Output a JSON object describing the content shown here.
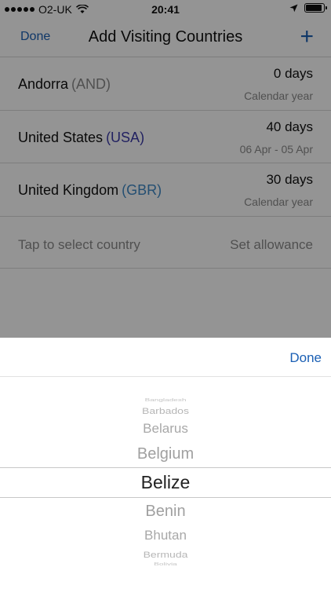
{
  "status": {
    "carrier": "O2-UK",
    "time": "20:41"
  },
  "nav": {
    "done": "Done",
    "title": "Add Visiting Countries",
    "add": "+"
  },
  "countries": [
    {
      "name": "Andorra",
      "code": "(AND)",
      "code_color": "#8b8b8b",
      "days": "0 days",
      "period": "Calendar year"
    },
    {
      "name": "United States",
      "code": "(USA)",
      "code_color": "#3b3aa8",
      "days": "40 days",
      "period": "06 Apr - 05 Apr"
    },
    {
      "name": "United Kingdom",
      "code": "(GBR)",
      "code_color": "#3f88c5",
      "days": "30 days",
      "period": "Calendar year"
    }
  ],
  "new_row": {
    "prompt": "Tap to select country",
    "allowance": "Set allowance"
  },
  "picker": {
    "done": "Done",
    "items": [
      "Bangladesh",
      "Barbados",
      "Belarus",
      "Belgium",
      "Belize",
      "Benin",
      "Bhutan",
      "Bermuda",
      "Bolivia"
    ],
    "selected": "Belize"
  },
  "colors": {
    "accent": "#1a5fb4",
    "overlay": "rgba(0,0,0,0.42)"
  }
}
